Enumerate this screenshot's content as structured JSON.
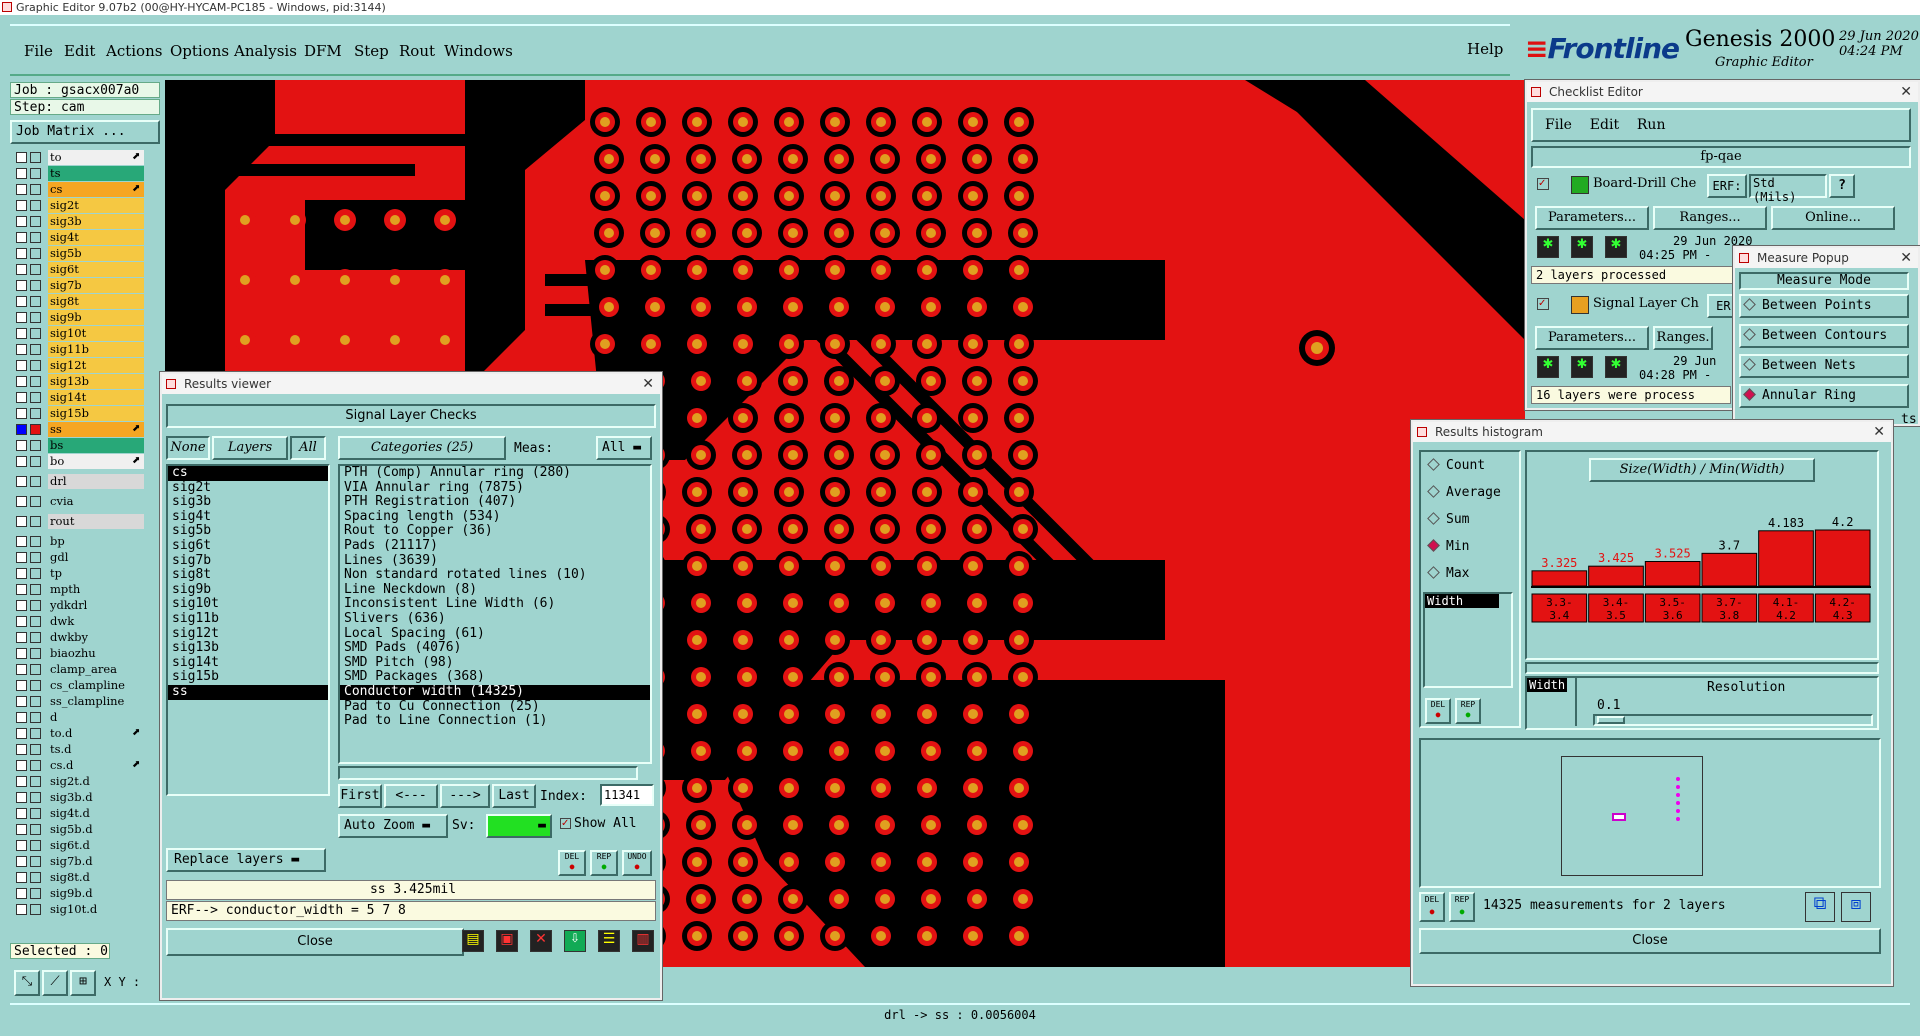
{
  "window_title": "Graphic Editor 9.07b2 (00@HY-HYCAM-PC185 - Windows, pid:3144)",
  "menu": [
    "File",
    "Edit",
    "Actions",
    "Options",
    "Analysis",
    "DFM",
    "Step",
    "Rout",
    "Windows"
  ],
  "help_label": "Help",
  "brand": {
    "logo": "Frontline",
    "product": "Genesis 2000",
    "subtitle": "Graphic Editor",
    "date": "29 Jun 2020",
    "time": "04:24 PM"
  },
  "job_panel": {
    "job": "Job : gsacx007a0",
    "step": "Step: cam",
    "job_matrix": "Job Matrix ...",
    "selected": "Selected : 0",
    "xy": "X Y :"
  },
  "layers": [
    {
      "name": "to",
      "color": "#f0f0f0",
      "arrow": true
    },
    {
      "name": "ts",
      "color": "#28a878"
    },
    {
      "name": "cs",
      "color": "#f5a623",
      "arrow": true
    },
    {
      "name": "sig2t",
      "color": "#f5c842"
    },
    {
      "name": "sig3b",
      "color": "#f5c842"
    },
    {
      "name": "sig4t",
      "color": "#f5c842"
    },
    {
      "name": "sig5b",
      "color": "#f5c842"
    },
    {
      "name": "sig6t",
      "color": "#f5c842"
    },
    {
      "name": "sig7b",
      "color": "#f5c842"
    },
    {
      "name": "sig8t",
      "color": "#f5c842"
    },
    {
      "name": "sig9b",
      "color": "#f5c842"
    },
    {
      "name": "sig10t",
      "color": "#f5c842"
    },
    {
      "name": "sig11b",
      "color": "#f5c842"
    },
    {
      "name": "sig12t",
      "color": "#f5c842"
    },
    {
      "name": "sig13b",
      "color": "#f5c842"
    },
    {
      "name": "sig14t",
      "color": "#f5c842"
    },
    {
      "name": "sig15b",
      "color": "#f5c842"
    },
    {
      "name": "ss",
      "color": "#f5a623",
      "arrow": true,
      "active": true
    },
    {
      "name": "bs",
      "color": "#28a878"
    },
    {
      "name": "bo",
      "color": "#f0f0f0",
      "arrow": true
    },
    {
      "name": "drl",
      "color": "#d8d8d8",
      "gap": true
    },
    {
      "name": "cvia",
      "color": "#9fd4cf",
      "gap": true
    },
    {
      "name": "rout",
      "color": "#d8d8d8",
      "gap": true
    },
    {
      "name": "bp",
      "color": "#9fd4cf",
      "gap": true
    },
    {
      "name": "gdl",
      "color": "#9fd4cf"
    },
    {
      "name": "tp",
      "color": "#9fd4cf"
    },
    {
      "name": "mpth",
      "color": "#9fd4cf"
    },
    {
      "name": "ydkdrl",
      "color": "#9fd4cf"
    },
    {
      "name": "dwk",
      "color": "#9fd4cf"
    },
    {
      "name": "dwkby",
      "color": "#9fd4cf"
    },
    {
      "name": "biaozhu",
      "color": "#9fd4cf"
    },
    {
      "name": "clamp_area",
      "color": "#9fd4cf"
    },
    {
      "name": "cs_clampline",
      "color": "#9fd4cf"
    },
    {
      "name": "ss_clampline",
      "color": "#9fd4cf"
    },
    {
      "name": "d",
      "color": "#9fd4cf"
    },
    {
      "name": "to.d",
      "color": "#9fd4cf",
      "arrow": true
    },
    {
      "name": "ts.d",
      "color": "#9fd4cf"
    },
    {
      "name": "cs.d",
      "color": "#9fd4cf",
      "arrow": true
    },
    {
      "name": "sig2t.d",
      "color": "#9fd4cf"
    },
    {
      "name": "sig3b.d",
      "color": "#9fd4cf"
    },
    {
      "name": "sig4t.d",
      "color": "#9fd4cf"
    },
    {
      "name": "sig5b.d",
      "color": "#9fd4cf"
    },
    {
      "name": "sig6t.d",
      "color": "#9fd4cf"
    },
    {
      "name": "sig7b.d",
      "color": "#9fd4cf"
    },
    {
      "name": "sig8t.d",
      "color": "#9fd4cf"
    },
    {
      "name": "sig9b.d",
      "color": "#9fd4cf"
    },
    {
      "name": "sig10t.d",
      "color": "#9fd4cf"
    }
  ],
  "status_bar": "drl -> ss : 0.0056004",
  "results_viewer": {
    "title": "Results viewer",
    "heading": "Signal Layer Checks",
    "none_btn": "None",
    "layers_btn": "Layers",
    "all_btn": "All",
    "categories_btn": "Categories (25)",
    "meas_label": "Meas:",
    "meas_value": "All",
    "layer_list": [
      "cs",
      "sig2t",
      "sig3b",
      "sig4t",
      "sig5b",
      "sig6t",
      "sig7b",
      "sig8t",
      "sig9b",
      "sig10t",
      "sig11b",
      "sig12t",
      "sig13b",
      "sig14t",
      "sig15b",
      "ss"
    ],
    "selected_layers": [
      "cs",
      "ss"
    ],
    "categories": [
      "PTH (Comp) Annular ring (280)",
      "VIA Annular ring (7875)",
      "PTH Registration (407)",
      "Spacing length (534)",
      "Rout to Copper (36)",
      "Pads (21117)",
      "Lines (3639)",
      "Non standard rotated lines (10)",
      "Line Neckdown (8)",
      "Inconsistent Line Width (6)",
      "Slivers (636)",
      "Local Spacing (61)",
      "SMD Pads (4076)",
      "SMD Pitch (98)",
      "SMD Packages (368)",
      "Conductor width (14325)",
      "Pad to Cu Connection (25)",
      "Pad to Line Connection (1)"
    ],
    "selected_category": "Conductor width (14325)",
    "nav": {
      "first": "First",
      "prev": "<---",
      "next": "--->",
      "last": "Last",
      "index_label": "Index:",
      "index_value": "11341"
    },
    "auto_zoom": "Auto Zoom",
    "sv_label": "Sv:",
    "show_all": "Show All",
    "replace_layers": "Replace layers",
    "icon_labels": [
      "DEL",
      "REP",
      "UNDO"
    ],
    "measure_text": "ss 3.425mil",
    "erf_text": "ERF--> conductor_width = 5 7 8",
    "close": "Close"
  },
  "checklist": {
    "title": "Checklist Editor",
    "menu": [
      "File",
      "Edit",
      "Run"
    ],
    "name": "fp-qae",
    "items": [
      {
        "name": "Board-Drill Che",
        "erf": "ERF:",
        "erf_value": "Std (Mils)",
        "q": "?",
        "params": "Parameters...",
        "ranges": "Ranges...",
        "online": "Online...",
        "date": "29 Jun 2020",
        "time": "04:25 PM -",
        "status": "2 layers processed"
      },
      {
        "name": "Signal Layer Ch",
        "erf": "ERF",
        "params": "Parameters...",
        "ranges": "Ranges.",
        "date": "29 Jun",
        "time": "04:28 PM -",
        "status": "16 layers were process"
      }
    ]
  },
  "measure_popup": {
    "title": "Measure Popup",
    "mode": "Measure Mode",
    "options": [
      "Between Points",
      "Between Contours",
      "Between Nets",
      "Annular Ring"
    ],
    "selected": "Annular Ring",
    "hidden_tail": "ts"
  },
  "histogram": {
    "title": "Results histogram",
    "stats": [
      "Count",
      "Average",
      "Sum",
      "Min",
      "Max"
    ],
    "selected_stat": "Min",
    "attr_list": [
      "Width"
    ],
    "chart_title": "Size(Width) / Min(Width)",
    "resolution_label": "Resolution",
    "resolution_value": "0.1",
    "attr_label": "Width",
    "summary": "14325 measurements for 2 layers",
    "close": "Close",
    "icon_labels": [
      "DEL",
      "REP"
    ]
  },
  "chart_data": {
    "type": "bar",
    "title": "Size(Width) / Min(Width)",
    "categories": [
      "3.3-3.4",
      "3.4-3.5",
      "3.5-3.6",
      "3.7-3.8",
      "4.1-4.2",
      "4.2-4.3"
    ],
    "values": [
      3.325,
      3.425,
      3.525,
      3.7,
      4.183,
      4.2
    ],
    "value_labels": [
      "3.325",
      "3.425",
      "3.525",
      "3.7",
      "4.183",
      "4.2"
    ],
    "ylim": [
      3.0,
      4.5
    ],
    "highlight_color": "#e31212",
    "label_colors": [
      "#e31212",
      "#e31212",
      "#e31212",
      "#000000",
      "#000000",
      "#000000"
    ]
  }
}
